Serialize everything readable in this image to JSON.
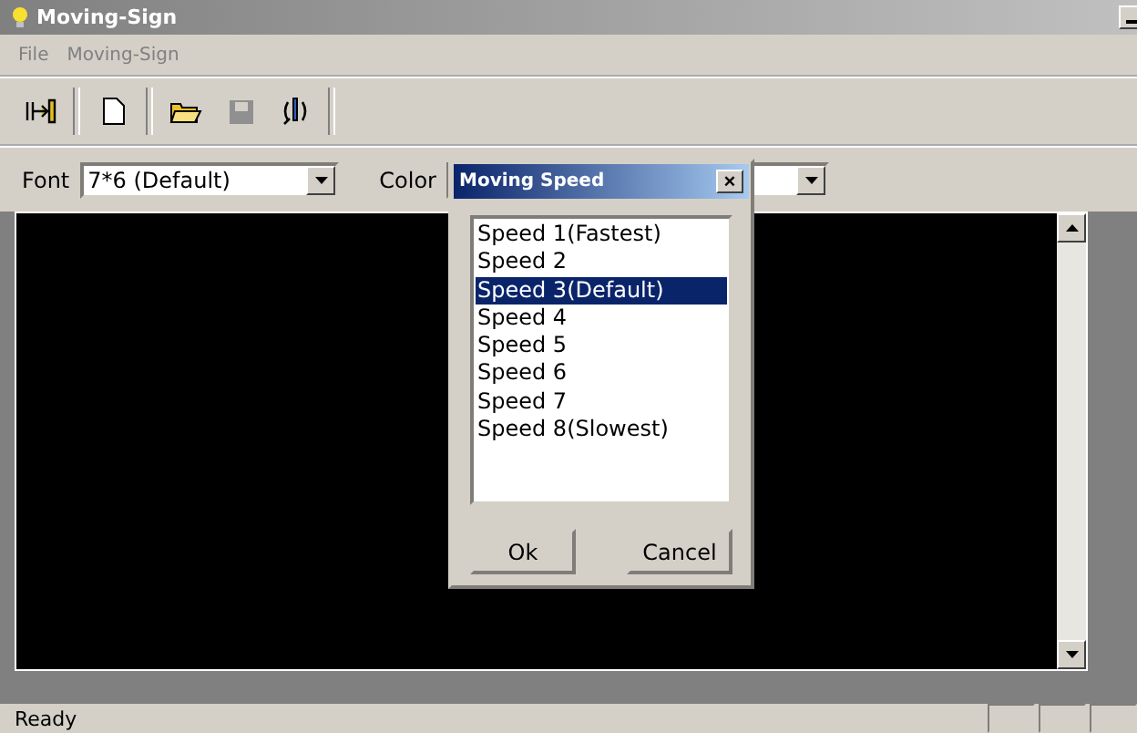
{
  "window": {
    "title": "Moving-Sign"
  },
  "menu": [
    "File",
    "Moving-Sign"
  ],
  "toolbar": [
    {
      "kind": "connect",
      "disabled": false
    },
    {
      "kind": "new",
      "disabled": false
    },
    {
      "kind": "open",
      "disabled": false
    },
    {
      "kind": "save",
      "disabled": true
    },
    {
      "kind": "send",
      "disabled": false
    }
  ],
  "font": {
    "label": "Font",
    "value": "7*6 (Default)"
  },
  "color": {
    "label": "Color"
  },
  "dialog": {
    "title": "Moving Speed",
    "close": "×",
    "items": [
      {
        "label": "Speed 1(Fastest)",
        "selected": false
      },
      {
        "label": "Speed 2",
        "selected": false
      },
      {
        "label": "Speed 3(Default)",
        "selected": true
      },
      {
        "label": "Speed 4",
        "selected": false
      },
      {
        "label": "Speed 5",
        "selected": false
      },
      {
        "label": "Speed 6",
        "selected": false
      },
      {
        "label": "Speed 7",
        "selected": false
      },
      {
        "label": "Speed 8(Slowest)",
        "selected": false
      }
    ],
    "buttons": [
      "Ok",
      "Cancel"
    ]
  },
  "status_bar": {
    "text": "Ready"
  }
}
